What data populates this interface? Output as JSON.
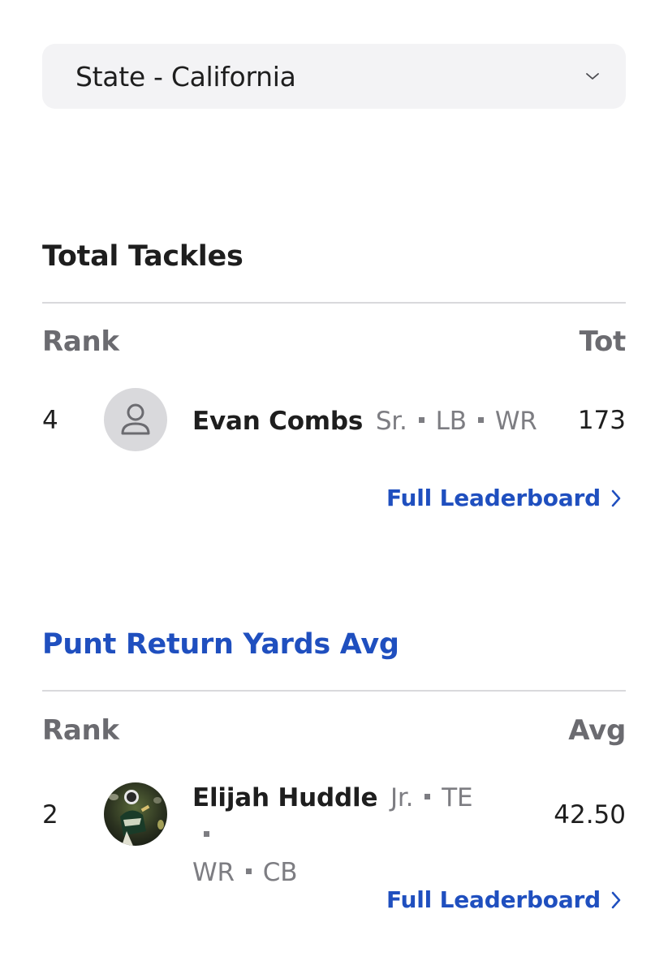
{
  "filter": {
    "selected": "State - California",
    "icon": "chevron-down-icon"
  },
  "sections": [
    {
      "title": "Total Tackles",
      "title_color": "#1e1e1e",
      "rank_header": "Rank",
      "stat_header": "Tot",
      "entry": {
        "rank": "4",
        "name": "Evan Combs",
        "meta": [
          "Sr.",
          "LB",
          "WR"
        ],
        "value": "173",
        "avatar_icon": "person-icon"
      },
      "link_label": "Full Leaderboard"
    },
    {
      "title": "Punt Return Yards Avg",
      "title_color": "#1f4fbf",
      "rank_header": "Rank",
      "stat_header": "Avg",
      "entry": {
        "rank": "2",
        "name": "Elijah Huddle",
        "meta": [
          "Jr.",
          "TE",
          "WR",
          "CB"
        ],
        "value": "42.50",
        "avatar_icon": "player-photo"
      },
      "link_label": "Full Leaderboard"
    }
  ],
  "colors": {
    "accent": "#1f4fbf",
    "muted": "#6b6b70",
    "divider": "#d9d9dc"
  }
}
